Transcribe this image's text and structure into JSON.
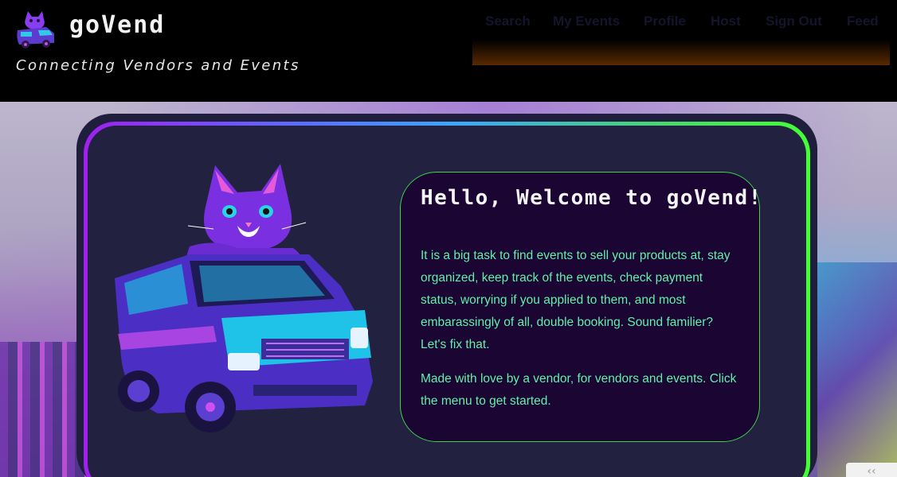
{
  "header": {
    "brand": "goVend",
    "tagline": "Connecting Vendors and Events"
  },
  "nav": {
    "items": [
      "Search",
      "My Events",
      "Profile",
      "Host",
      "Sign Out",
      "Feed"
    ]
  },
  "welcome": {
    "title": "Hello, Welcome to goVend!",
    "paragraph1": "It is a big task to find events to sell your products at, stay organized, keep track of the events, check payment status, worrying if you applied to them, and most embarassingly of all, double booking. Sound familier? Let's fix that.",
    "paragraph2": "Made with love by a vendor, for vendors and events. Click the menu to get started."
  },
  "colors": {
    "header_bg": "#000000",
    "card_bg": "#222140",
    "welcome_bg": "#1a0533",
    "welcome_border": "#3ad64a",
    "text_green": "#63f0a8",
    "nav_text": "#14142b"
  },
  "icons": [
    "logo-cat-van-icon",
    "hero-cat-van-illustration"
  ]
}
